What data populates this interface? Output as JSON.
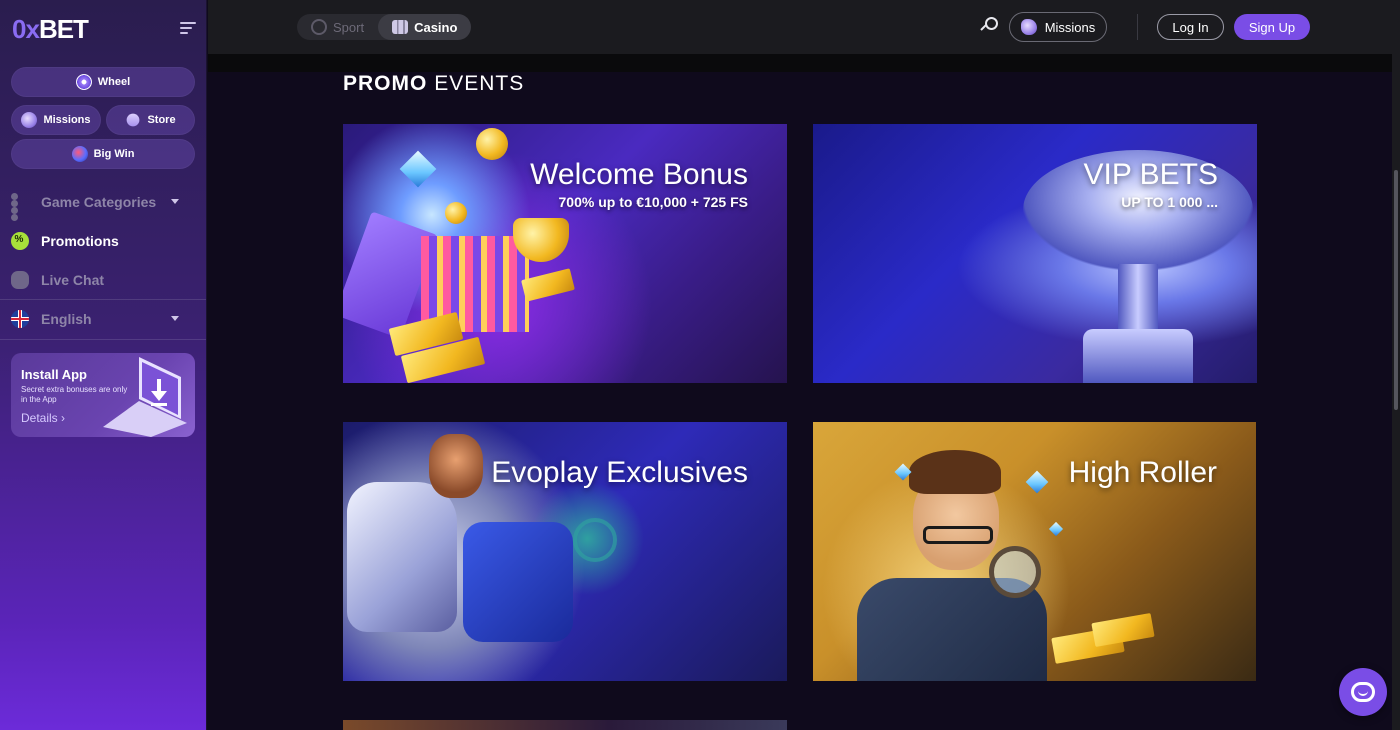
{
  "brand": {
    "zero": "0",
    "x": "x",
    "bet": "BET"
  },
  "sidebar": {
    "pills": {
      "wheel": "Wheel",
      "missions": "Missions",
      "store": "Store",
      "big_win": "Big Win"
    },
    "nav": {
      "game_categories": "Game Categories",
      "promotions": "Promotions",
      "live_chat": "Live Chat",
      "language": "English"
    },
    "install": {
      "title": "Install App",
      "subtitle": "Secret extra bonuses are only in the App",
      "details": "Details",
      "details_arrow": "›"
    }
  },
  "header": {
    "toggle": {
      "sport": "Sport",
      "casino": "Casino"
    },
    "missions": "Missions",
    "login": "Log In",
    "signup": "Sign Up"
  },
  "main": {
    "title_bold": "PROMO",
    "title_light": "EVENTS",
    "cards": [
      {
        "title": "Welcome Bonus",
        "subtitle": "700% up to €10,000 + 725 FS"
      },
      {
        "title": "VIP BETS",
        "subtitle": "UP TO 1 000 ..."
      },
      {
        "title": "Evoplay Exclusives",
        "subtitle": ""
      },
      {
        "title": "High Roller",
        "subtitle": ""
      }
    ]
  },
  "icons": {
    "menu": "menu-icon",
    "search": "search-icon",
    "chat": "chat-bubble-icon"
  },
  "colors": {
    "accent": "#7a4de6",
    "background": "#0f0a1c",
    "header": "#1b1b1f"
  }
}
